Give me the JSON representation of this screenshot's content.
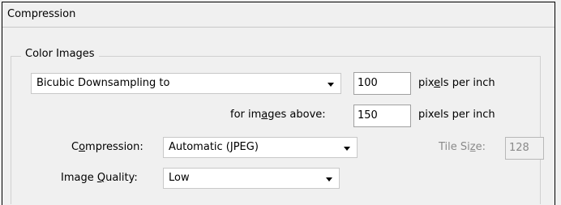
{
  "section": {
    "title": "Compression"
  },
  "color_images": {
    "title": "Color Images",
    "downsample": {
      "selected": "Bicubic Downsampling to",
      "resolution": "100",
      "unit": "pixels per inch"
    },
    "above": {
      "label": "for images above:",
      "resolution": "150",
      "unit": "pixels per inch"
    },
    "compression": {
      "label": "Compression:",
      "selected": "Automatic (JPEG)"
    },
    "tile_size": {
      "label": "Tile Size:",
      "value": "128"
    },
    "quality": {
      "label": "Image Quality:",
      "selected": "Low"
    }
  }
}
